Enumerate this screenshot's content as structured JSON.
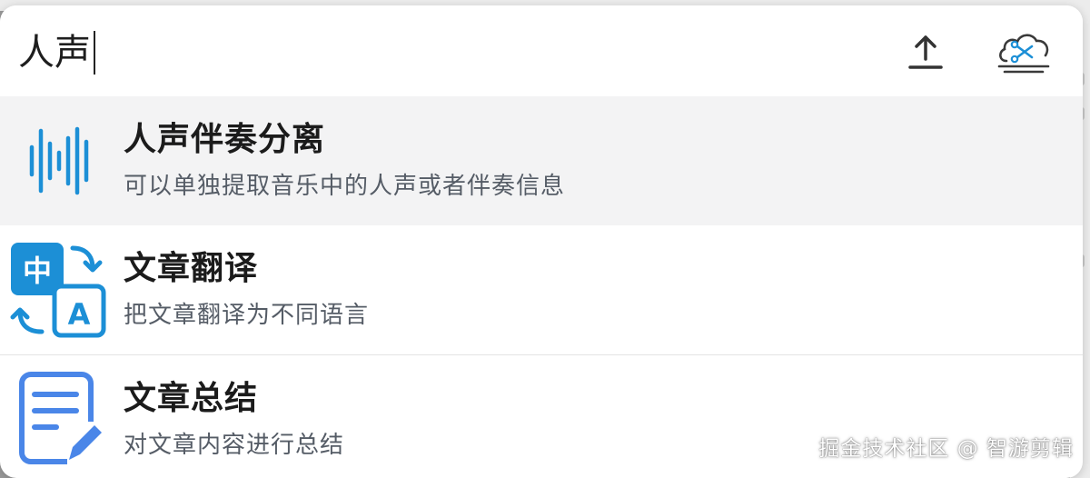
{
  "search": {
    "value": "人声",
    "upload_icon": "upload-icon",
    "cloud_icon": "cloud-scissors-icon"
  },
  "results": [
    {
      "icon": "waveform-icon",
      "title": "人声伴奏分离",
      "description": "可以单独提取音乐中的人声或者伴奏信息",
      "selected": true
    },
    {
      "icon": "translate-icon",
      "title": "文章翻译",
      "description": "把文章翻译为不同语言",
      "selected": false
    },
    {
      "icon": "document-edit-icon",
      "title": "文章总结",
      "description": "对文章内容进行总结",
      "selected": false
    }
  ],
  "watermark": "掘金技术社区 @ 智游剪辑",
  "colors": {
    "accent_blue": "#1c8fd6",
    "doc_blue": "#4a86e8",
    "selected_bg": "#f3f3f4"
  }
}
